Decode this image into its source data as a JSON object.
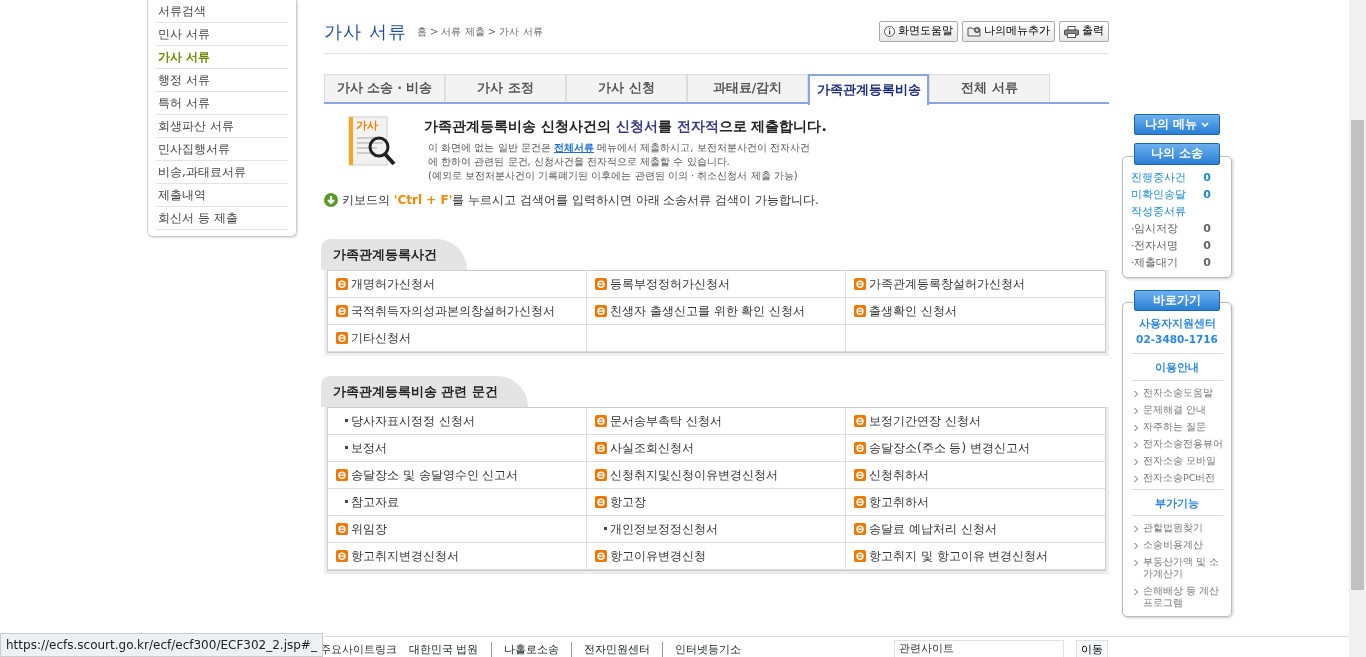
{
  "left_menu": [
    {
      "label": "서류검색",
      "selected": false
    },
    {
      "label": "민사 서류",
      "selected": false
    },
    {
      "label": "가사 서류",
      "selected": true
    },
    {
      "label": "행정 서류",
      "selected": false
    },
    {
      "label": "특허 서류",
      "selected": false
    },
    {
      "label": "회생파산 서류",
      "selected": false
    },
    {
      "label": "민사집행서류",
      "selected": false
    },
    {
      "label": "비송,과태료서류",
      "selected": false
    },
    {
      "label": "제출내역",
      "selected": false
    },
    {
      "label": "회신서 등 제출",
      "selected": false
    }
  ],
  "page_title": "가사 서류",
  "breadcrumb": "홈 > 서류 제출 > 가사 서류",
  "toolbar": [
    {
      "label": "화면도움말",
      "kind": "info"
    },
    {
      "label": "나의메뉴추가",
      "kind": "folder"
    },
    {
      "label": "출력",
      "kind": "print"
    }
  ],
  "tabs": [
    {
      "label": "가사 소송 · 비송",
      "selected": false
    },
    {
      "label": "가사 조정",
      "selected": false
    },
    {
      "label": "가사 신청",
      "selected": false
    },
    {
      "label": "과태료/감치",
      "selected": false
    },
    {
      "label": "가족관계등록비송",
      "selected": true
    },
    {
      "label": "전체 서류",
      "selected": false
    }
  ],
  "intro": {
    "icon_label": "가사",
    "headline": "가족관계등록비송 신청사건의 **신청서**를 **전자적**으로 제출합니다.",
    "desc_before": "이 화면에 없는 일반 문건은",
    "desc_link": "전체서류",
    "desc_after": "메뉴에서 제출하시고, 보전처분사건이 전자사건에 한하여 관련된 문건, 신청사건을 전자적으로 제출할 수 있습니다.",
    "note": "(예외로 보전처분사건이 기록폐기된 이후에는 관련된 이의 · 취소신청서 제출 가능)"
  },
  "hint_before": "키보드의 ",
  "hint_key": "'Ctrl + F'",
  "hint_after": "를 누르시고 검색어를 입력하시면 아래 소송서류 검색이 가능합니다.",
  "sections": [
    {
      "title": "가족관계등록사건",
      "rows": [
        [
          {
            "label": "개명허가신청서",
            "kind": "electronic"
          },
          {
            "label": "등록부정정허가신청서",
            "kind": "electronic"
          },
          {
            "label": "가족관계등록창설허가신청서",
            "kind": "electronic"
          }
        ],
        [
          {
            "label": "국적취득자의성과본의창설허가신청서",
            "kind": "electronic"
          },
          {
            "label": "친생자 출생신고를 위한 확인 신청서",
            "kind": "electronic"
          },
          {
            "label": "출생확인 신청서",
            "kind": "electronic"
          }
        ],
        [
          {
            "label": "기타신청서",
            "kind": "electronic"
          },
          {
            "kind": "empty"
          },
          {
            "kind": "empty"
          }
        ]
      ]
    },
    {
      "title": "가족관계등록비송 관련 문건",
      "rows": [
        [
          {
            "label": "당사자표시정정 신청서",
            "kind": "paper"
          },
          {
            "label": "문서송부촉탁 신청서",
            "kind": "electronic"
          },
          {
            "label": "보정기간연장 신청서",
            "kind": "electronic"
          }
        ],
        [
          {
            "label": "보정서",
            "kind": "paper"
          },
          {
            "label": "사실조회신청서",
            "kind": "electronic"
          },
          {
            "label": "송달장소(주소 등) 변경신고서",
            "kind": "electronic"
          }
        ],
        [
          {
            "label": "송달장소 및 송달영수인 신고서",
            "kind": "electronic"
          },
          {
            "label": "신청취지및신청이유변경신청서",
            "kind": "electronic"
          },
          {
            "label": "신청취하서",
            "kind": "electronic"
          }
        ],
        [
          {
            "label": "참고자료",
            "kind": "paper"
          },
          {
            "label": "항고장",
            "kind": "electronic"
          },
          {
            "label": "항고취하서",
            "kind": "electronic"
          }
        ],
        [
          {
            "label": "위임장",
            "kind": "electronic"
          },
          {
            "label": "개인정보정정신청서",
            "kind": "paper"
          },
          {
            "label": "송달료 예납처리 신청서",
            "kind": "electronic"
          }
        ],
        [
          {
            "label": "항고취지변경신청서",
            "kind": "electronic"
          },
          {
            "label": "항고이유변경신청",
            "kind": "electronic"
          },
          {
            "label": "항고취지 및 항고이유 변경신청서",
            "kind": "electronic"
          }
        ]
      ]
    }
  ],
  "my_menu_button": "나의 메뉴",
  "my_case": {
    "title": "나의 소송",
    "items": [
      {
        "label": "진행중사건",
        "count": "0",
        "kind": "main"
      },
      {
        "label": "미확인송달",
        "count": "0",
        "kind": "main"
      },
      {
        "label": "작성중서류",
        "kind": "main"
      },
      {
        "label": "·임시저장",
        "count": "0",
        "kind": "sub"
      },
      {
        "label": "·전자서명",
        "count": "0",
        "kind": "sub"
      },
      {
        "label": "·제출대기",
        "count": "0",
        "kind": "sub"
      }
    ]
  },
  "shortcuts": {
    "title": "바로가기",
    "center": "사용자지원센터",
    "phone": "02-3480-1716",
    "groups": [
      {
        "title": "이용안내",
        "links": [
          "전자소송도움말",
          "문제해결 안내",
          "자주하는 질문",
          "전자소송전용뷰어",
          "전자소송 모바일",
          "전자소송PC버전"
        ]
      },
      {
        "title": "부가기능",
        "links": [
          "관할법원찾기",
          "소송비용계산",
          "부동산가액 및 소가계산기",
          "손해배상 등 계산 프로그램"
        ]
      }
    ]
  },
  "footer": {
    "label": "주요사이트링크",
    "links": [
      "대한민국 법원",
      "나홀로소송",
      "전자민원센터",
      "인터넷등기소"
    ],
    "select": "관련사이트",
    "go": "이동"
  },
  "status_bar": "https://ecfs.scourt.go.kr/ecf/ecf300/ECF302_2.jsp#_"
}
